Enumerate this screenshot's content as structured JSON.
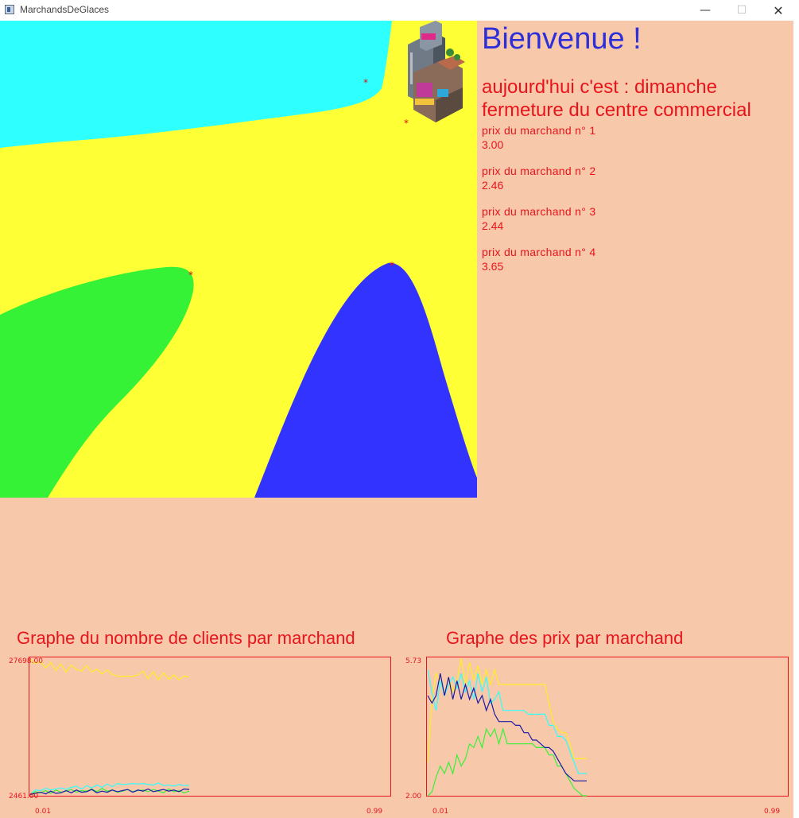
{
  "window": {
    "title": "MarchandsDeGlaces",
    "minimize_glyph": "—",
    "maximize_glyph": "☐",
    "close_glyph": "✕"
  },
  "panel": {
    "welcome": "Bienvenue !",
    "day_line": "aujourd'hui c'est : dimanche",
    "event_line": "fermeture du centre commercial",
    "merchants": [
      {
        "label": "prix du marchand n° 1",
        "price": "3.00"
      },
      {
        "label": "prix du marchand n° 2",
        "price": "2.46"
      },
      {
        "label": "prix du marchand n° 3",
        "price": "2.44"
      },
      {
        "label": "prix du marchand n° 4",
        "price": "3.65"
      }
    ]
  },
  "map": {
    "icon": "mall-building-icon",
    "region_colors": {
      "cyan": "#2effff",
      "yellow": "#ffff36",
      "green": "#36f236",
      "blue": "#3333ff"
    },
    "marker_color": "#dd1111"
  },
  "graphs": {
    "clients": {
      "title": "Graphe du nombre de clients par marchand",
      "y_max": "27698.00",
      "y_min": "2461.00",
      "x_min": "0.01",
      "x_max": "0.99"
    },
    "prices": {
      "title": "Graphe des prix par marchand",
      "y_max": "5.73",
      "y_min": "2.00",
      "x_min": "0.01",
      "x_max": "0.99"
    }
  },
  "chart_data": [
    {
      "type": "line",
      "title": "Graphe du nombre de clients par marchand",
      "ylim": [
        2461.0,
        27698.0
      ],
      "x_range": [
        0.01,
        0.99
      ],
      "series": [
        {
          "color": "#ffee22",
          "values": [
            27400,
            26600,
            26900,
            25800,
            26800,
            25300,
            26500,
            25000,
            26300,
            25500,
            25200,
            26200,
            25000,
            25600,
            24700,
            25400,
            24600,
            24300,
            24200,
            24300,
            24200,
            24500,
            25200,
            23800,
            25100,
            23600,
            24900,
            23700,
            24500,
            23600,
            24300,
            24100
          ]
        },
        {
          "color": "#2effff",
          "values": [
            2700,
            3500,
            3400,
            3800,
            3500,
            3700,
            3900,
            3600,
            4000,
            4200,
            3700,
            4300,
            3900,
            4400,
            4000,
            4600,
            4100,
            4700,
            4500,
            4600,
            4700,
            4600,
            4700,
            4500,
            4400,
            4800,
            4300,
            4400,
            4200,
            4500,
            4300,
            4400
          ]
        },
        {
          "color": "#36f236",
          "values": [
            2600,
            3200,
            3000,
            3400,
            2900,
            3500,
            3100,
            3300,
            3600,
            3100,
            3400,
            3300,
            3700,
            3200,
            3800,
            3300,
            3500,
            3100,
            3300,
            3600,
            3200,
            3400,
            3500,
            3200,
            3600,
            3300,
            3000,
            3700,
            3200,
            3400,
            3000,
            3300
          ]
        },
        {
          "color": "#1a1aa8",
          "values": [
            2700,
            2900,
            3100,
            2800,
            3300,
            2900,
            3000,
            3400,
            3000,
            3500,
            3100,
            3200,
            3600,
            3000,
            3300,
            3100,
            3500,
            3200,
            3400,
            3600,
            3100,
            3500,
            3300,
            3700,
            3200,
            3400,
            3600,
            3300,
            3500,
            3200,
            3700,
            3600
          ]
        }
      ]
    },
    {
      "type": "line",
      "title": "Graphe des prix par marchand",
      "ylim": [
        2.0,
        5.73
      ],
      "x_range": [
        0.01,
        0.99
      ],
      "series": [
        {
          "color": "#ffee22",
          "values": [
            2.9,
            4.6,
            5.3,
            5.1,
            4.7,
            5.2,
            4.8,
            5.1,
            5.7,
            5.0,
            5.6,
            5.1,
            5.5,
            5.0,
            5.4,
            5.0,
            5.4,
            5.0,
            5.0,
            5.0,
            5.0,
            5.0,
            5.0,
            5.0,
            5.0,
            5.0,
            5.0,
            5.0,
            5.0,
            4.5,
            4.0,
            3.8,
            3.7,
            3.7,
            3.4,
            3.0,
            3.0,
            3.0,
            3.0
          ]
        },
        {
          "color": "#2effff",
          "values": [
            5.4,
            4.8,
            4.3,
            5.1,
            4.7,
            5.0,
            5.2,
            4.9,
            5.3,
            4.8,
            5.1,
            4.6,
            5.3,
            4.8,
            5.2,
            4.5,
            4.6,
            4.8,
            4.3,
            4.3,
            4.3,
            4.3,
            4.3,
            4.3,
            4.2,
            4.2,
            4.2,
            4.2,
            4.2,
            3.9,
            3.9,
            3.6,
            3.6,
            3.5,
            3.2,
            2.9,
            2.6,
            2.6,
            2.6
          ]
        },
        {
          "color": "#36f236",
          "values": [
            2.0,
            2.1,
            2.5,
            2.8,
            2.6,
            2.9,
            2.6,
            3.1,
            2.8,
            3.0,
            3.4,
            3.3,
            3.6,
            3.3,
            3.8,
            3.6,
            3.8,
            3.4,
            3.8,
            3.4,
            3.4,
            3.4,
            3.4,
            3.4,
            3.4,
            3.4,
            3.3,
            3.3,
            3.3,
            3.1,
            3.1,
            2.8,
            2.8,
            2.6,
            2.4,
            2.2,
            2.1,
            2.0,
            2.0
          ]
        },
        {
          "color": "#1a1aa8",
          "values": [
            4.7,
            4.5,
            4.7,
            5.3,
            4.7,
            5.2,
            4.6,
            5.1,
            4.6,
            5.0,
            4.6,
            4.9,
            4.5,
            4.7,
            4.3,
            4.6,
            4.2,
            4.0,
            4.0,
            4.0,
            4.0,
            3.9,
            3.9,
            3.7,
            3.7,
            3.5,
            3.5,
            3.4,
            3.3,
            3.3,
            3.2,
            3.0,
            2.8,
            2.6,
            2.5,
            2.4,
            2.4,
            2.4,
            2.4
          ]
        }
      ]
    }
  ]
}
